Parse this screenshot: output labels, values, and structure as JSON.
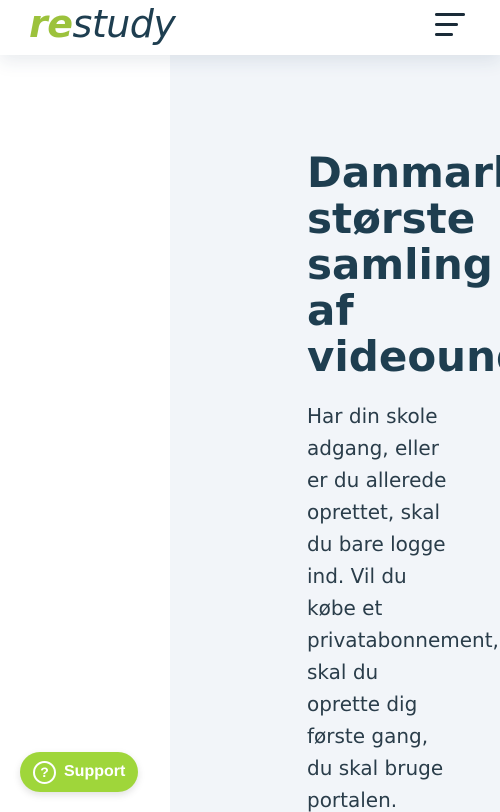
{
  "header": {
    "logo": {
      "part1": "re",
      "part2": "study"
    },
    "menu_icon": "hamburger-menu-icon"
  },
  "hero": {
    "title": "Danmarks\nstørste\nsamling\naf\nvideoundervisning",
    "body": "Har din skole\nadgang, eller\ner du allerede\noprettet, skal\ndu bare logge\nind. Vil du\nkøbe et\nprivatabonnement,\nskal du\noprette dig\nførste gang,\ndu skal bruge\nportalen."
  },
  "support": {
    "icon": "question-circle-icon",
    "icon_glyph": "?",
    "label": "Support"
  },
  "colors": {
    "brand_green": "#9cc23c",
    "navy": "#1e3e50",
    "support_green": "#9fd63a",
    "panel_bg": "#f2f5f9"
  }
}
